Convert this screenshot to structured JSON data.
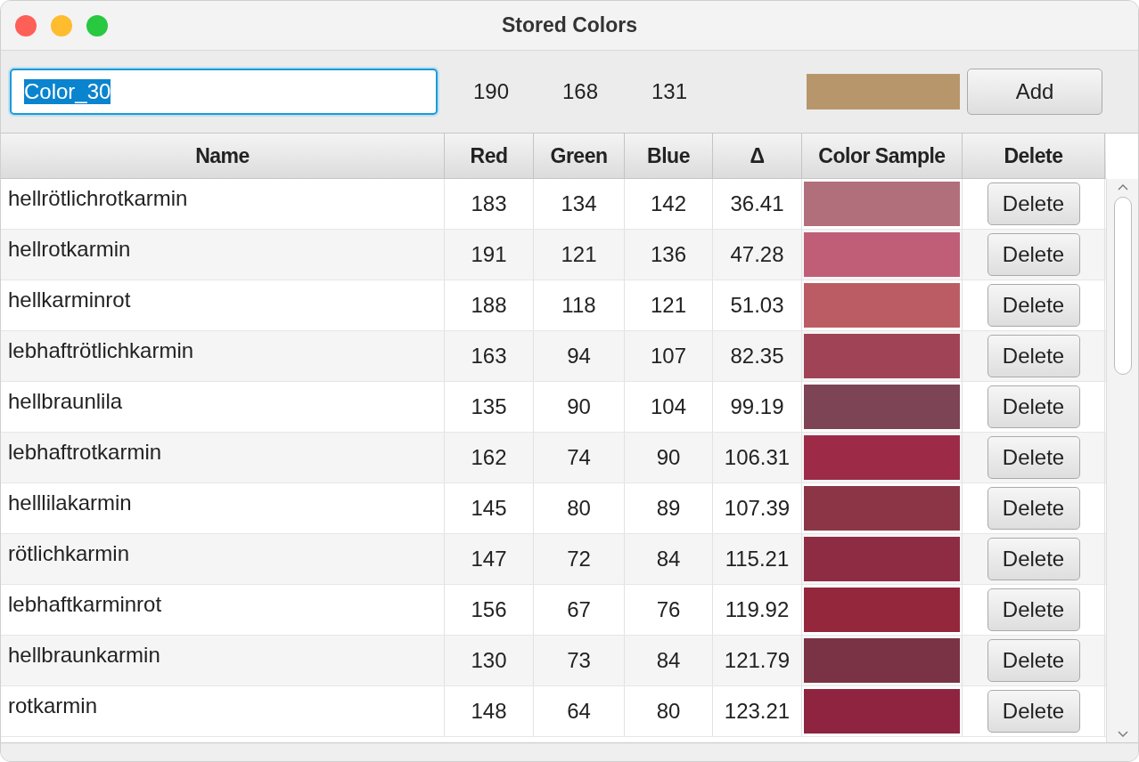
{
  "window": {
    "title": "Stored Colors"
  },
  "entry": {
    "value": "Color_30",
    "text_selected": true,
    "red": "190",
    "green": "168",
    "blue": "131",
    "color": "#b8966c",
    "button": "Add"
  },
  "table": {
    "columns": [
      "Name",
      "Red",
      "Green",
      "Blue",
      "Δ",
      "Color Sample",
      "Delete"
    ],
    "rows": [
      {
        "name": "hellrötlichrotkarmin",
        "red": "183",
        "green": "134",
        "blue": "142",
        "delta": "36.41",
        "color": "#b16e7b",
        "action": "Delete"
      },
      {
        "name": "hellrotkarmin",
        "red": "191",
        "green": "121",
        "blue": "136",
        "delta": "47.28",
        "color": "#c05e77",
        "action": "Delete"
      },
      {
        "name": "hellkarminrot",
        "red": "188",
        "green": "118",
        "blue": "121",
        "delta": "51.03",
        "color": "#bb5c64",
        "action": "Delete"
      },
      {
        "name": "lebhaftrötlichkarmin",
        "red": "163",
        "green": "94",
        "blue": "107",
        "delta": "82.35",
        "color": "#a14356",
        "action": "Delete"
      },
      {
        "name": "hellbraunlila",
        "red": "135",
        "green": "90",
        "blue": "104",
        "delta": "99.19",
        "color": "#7c4455",
        "action": "Delete"
      },
      {
        "name": "lebhaftrotkarmin",
        "red": "162",
        "green": "74",
        "blue": "90",
        "delta": "106.31",
        "color": "#9d2b47",
        "action": "Delete"
      },
      {
        "name": "helllilakarmin",
        "red": "145",
        "green": "80",
        "blue": "89",
        "delta": "107.39",
        "color": "#8c3546",
        "action": "Delete"
      },
      {
        "name": "rötlichkarmin",
        "red": "147",
        "green": "72",
        "blue": "84",
        "delta": "115.21",
        "color": "#8e2c43",
        "action": "Delete"
      },
      {
        "name": "lebhaftkarminrot",
        "red": "156",
        "green": "67",
        "blue": "76",
        "delta": "119.92",
        "color": "#94273b",
        "action": "Delete"
      },
      {
        "name": "hellbraunkarmin",
        "red": "130",
        "green": "73",
        "blue": "84",
        "delta": "121.79",
        "color": "#7a3344",
        "action": "Delete"
      },
      {
        "name": "rotkarmin",
        "red": "148",
        "green": "64",
        "blue": "80",
        "delta": "123.21",
        "color": "#8f2440",
        "action": "Delete"
      }
    ]
  }
}
